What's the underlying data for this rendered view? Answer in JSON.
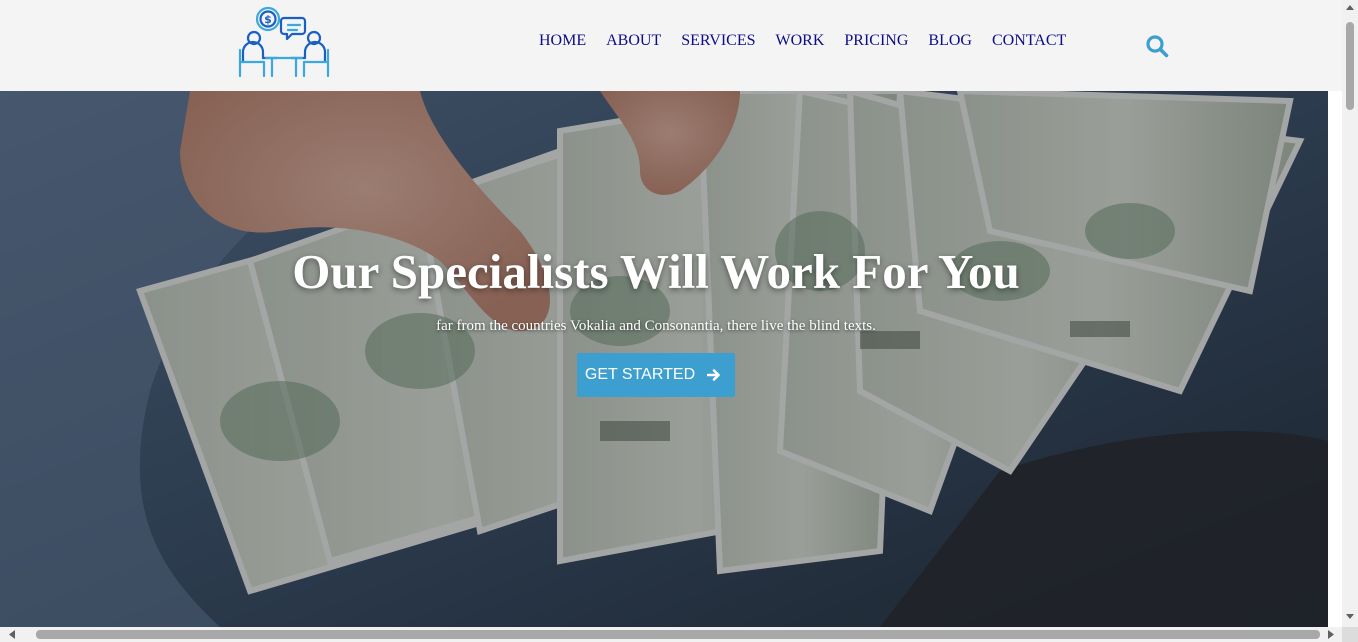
{
  "header": {
    "logo_icon": "consultation-money-icon",
    "nav": [
      {
        "label": "HOME"
      },
      {
        "label": "ABOUT"
      },
      {
        "label": "SERVICES"
      },
      {
        "label": "WORK"
      },
      {
        "label": "PRICING"
      },
      {
        "label": "BLOG"
      },
      {
        "label": "CONTACT"
      }
    ],
    "search_icon": "search-icon",
    "colors": {
      "nav_text": "#0d0d8a",
      "accent": "#3c9fd0",
      "background": "#f4f4f4"
    }
  },
  "hero": {
    "background_image": "hand-holding-fanned-hundred-dollar-bills",
    "title": "Our Specialists Will Work For You",
    "subtitle": "far from the countries Vokalia and Consonantia, there live the blind texts.",
    "cta": {
      "label": "GET STARTED",
      "icon": "arrow-right-icon",
      "color": "#3c9fd0"
    }
  },
  "scrollbars": {
    "vertical": true,
    "horizontal": true
  }
}
